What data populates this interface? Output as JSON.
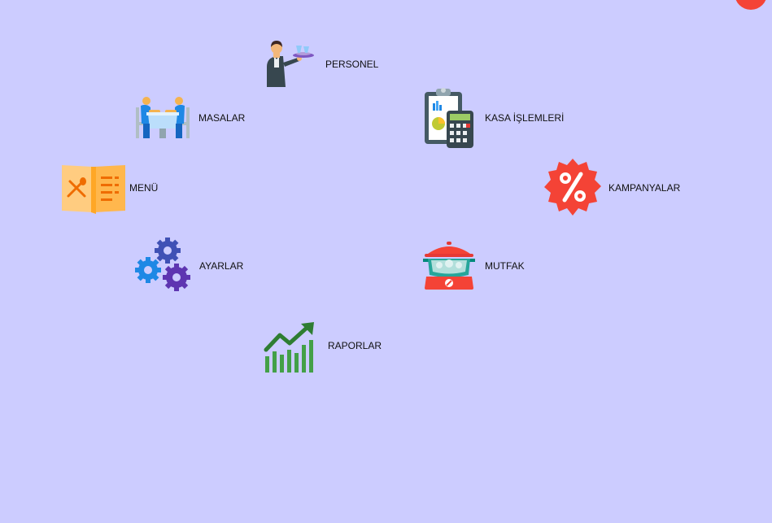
{
  "menu_items": {
    "personel": {
      "label": "PERSONEL",
      "icon": "waiter-icon"
    },
    "masalar": {
      "label": "MASALAR",
      "icon": "dining-table-icon"
    },
    "kasa": {
      "label": "KASA İŞLEMLERİ",
      "icon": "calculator-clipboard-icon"
    },
    "menu": {
      "label": "MENÜ",
      "icon": "menu-book-icon"
    },
    "kampanyalar": {
      "label": "KAMPANYALAR",
      "icon": "percent-badge-icon"
    },
    "ayarlar": {
      "label": "AYARLAR",
      "icon": "gears-icon"
    },
    "mutfak": {
      "label": "MUTFAK",
      "icon": "cooking-pot-icon"
    },
    "raporlar": {
      "label": "RAPORLAR",
      "icon": "growth-chart-icon"
    }
  },
  "colors": {
    "background": "#ccccff",
    "close_button": "#f44336"
  }
}
